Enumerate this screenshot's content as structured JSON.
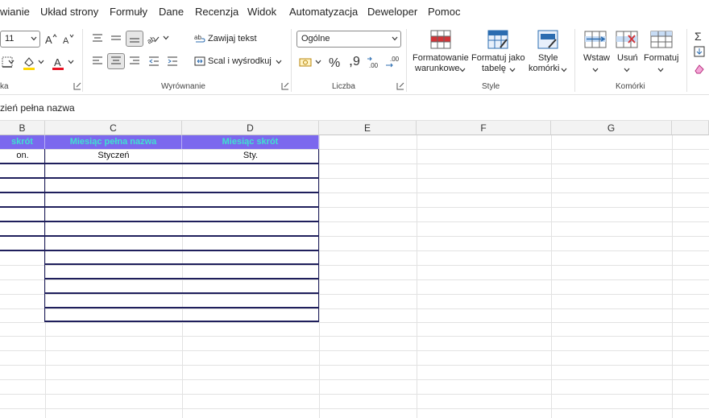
{
  "menu": {
    "tabs": [
      "wianie",
      "Układ strony",
      "Formuły",
      "Dane",
      "Recenzja",
      "Widok",
      "Automatyzacja",
      "Deweloper",
      "Pomoc"
    ]
  },
  "ribbon": {
    "font": {
      "size_value": "11",
      "group_label": "ka"
    },
    "alignment": {
      "wrap_text": "Zawijaj tekst",
      "merge_center": "Scal i wyśrodkuj",
      "group_label": "Wyrównanie"
    },
    "number": {
      "format_value": "Ogólne",
      "group_label": "Liczba"
    },
    "styles": {
      "conditional": [
        "Formatowanie",
        "warunkowe"
      ],
      "format_table": [
        "Formatuj jako",
        "tabelę"
      ],
      "cell_styles": [
        "Style",
        "komórki"
      ],
      "group_label": "Style"
    },
    "cells": {
      "insert": "Wstaw",
      "delete": "Usuń",
      "format": "Formatuj",
      "group_label": "Komórki"
    }
  },
  "formula_bar": {
    "content": "zień pełna nazwa"
  },
  "grid": {
    "column_headers": [
      "B",
      "C",
      "D",
      "E",
      "F",
      "G"
    ],
    "table_headers": [
      "skrót",
      "Miesiąc pełna nazwa",
      "Miesiąc skrót"
    ],
    "first_row": [
      "on.",
      "Styczeń",
      "Sty."
    ]
  },
  "colors": {
    "header_fill": "#7b68ee",
    "header_text": "#40e0d0",
    "table_border": "#1f1f5c",
    "accent_red": "#d13438",
    "accent_blue": "#2b6cb0"
  }
}
